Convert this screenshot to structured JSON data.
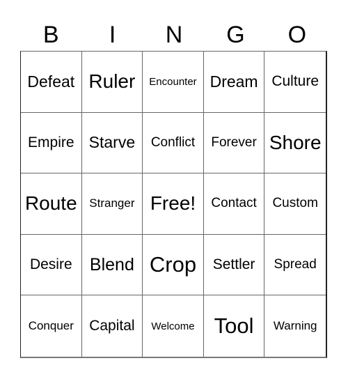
{
  "header": [
    "B",
    "I",
    "N",
    "G",
    "O"
  ],
  "cells": [
    "Defeat",
    "Ruler",
    "Encounter",
    "Dream",
    "Culture",
    "Empire",
    "Starve",
    "Conflict",
    "Forever",
    "Shore",
    "Route",
    "Stranger",
    "Free!",
    "Contact",
    "Custom",
    "Desire",
    "Blend",
    "Crop",
    "Settler",
    "Spread",
    "Conquer",
    "Capital",
    "Welcome",
    "Tool",
    "Warning"
  ]
}
